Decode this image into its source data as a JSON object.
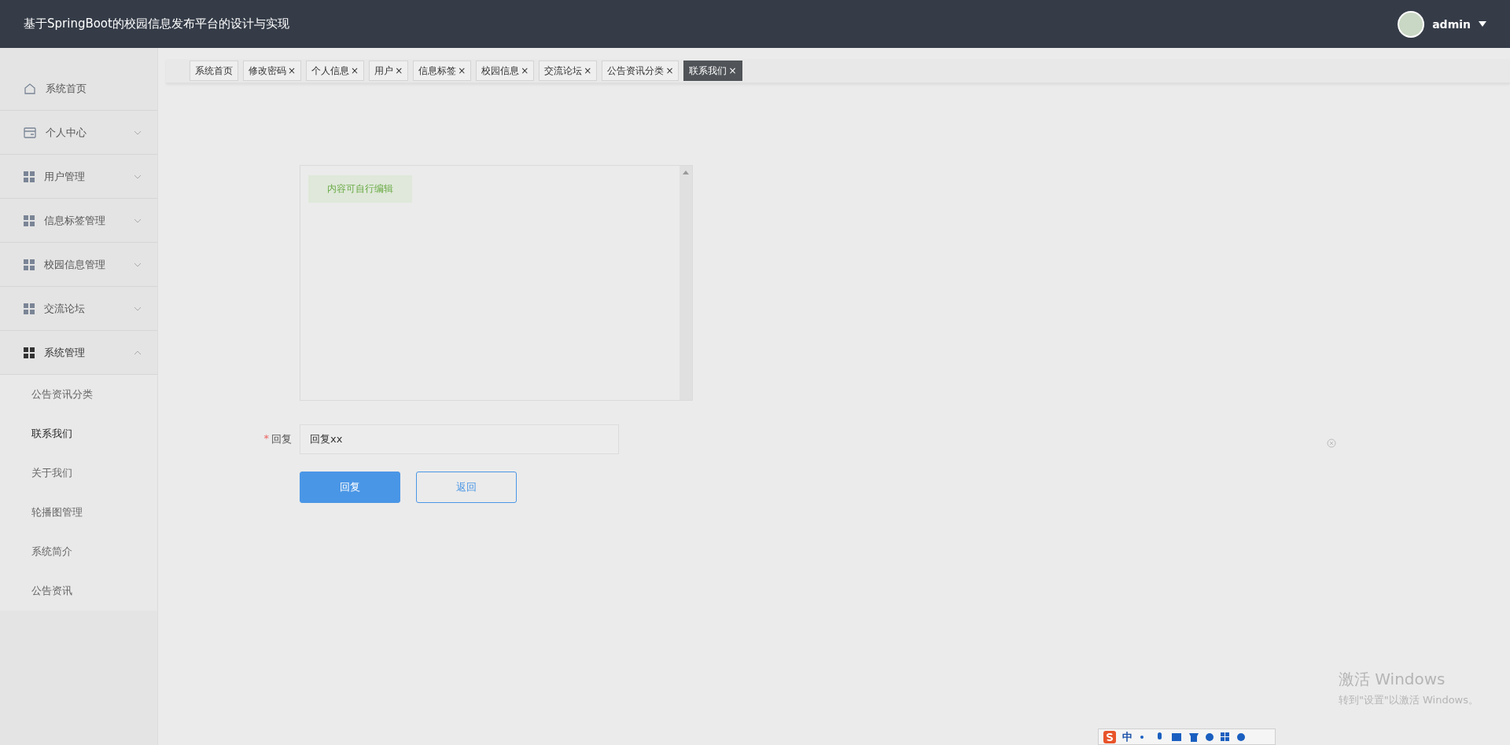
{
  "header": {
    "title": "基于SpringBoot的校园信息发布平台的设计与实现",
    "user": "admin"
  },
  "sidebar": {
    "items": [
      {
        "label": "系统首页",
        "expanded": false,
        "has_children": false
      },
      {
        "label": "个人中心",
        "expanded": false,
        "has_children": true
      },
      {
        "label": "用户管理",
        "expanded": false,
        "has_children": true
      },
      {
        "label": "信息标签管理",
        "expanded": false,
        "has_children": true
      },
      {
        "label": "校园信息管理",
        "expanded": false,
        "has_children": true
      },
      {
        "label": "交流论坛",
        "expanded": false,
        "has_children": true
      },
      {
        "label": "系统管理",
        "expanded": true,
        "has_children": true,
        "children": [
          {
            "label": "公告资讯分类",
            "selected": false
          },
          {
            "label": "联系我们",
            "selected": true
          },
          {
            "label": "关于我们",
            "selected": false
          },
          {
            "label": "轮播图管理",
            "selected": false
          },
          {
            "label": "系统简介",
            "selected": false
          },
          {
            "label": "公告资讯",
            "selected": false
          }
        ]
      }
    ]
  },
  "tabs": [
    {
      "label": "系统首页",
      "closable": false,
      "selected": false
    },
    {
      "label": "修改密码",
      "closable": true,
      "selected": false
    },
    {
      "label": "个人信息",
      "closable": true,
      "selected": false
    },
    {
      "label": "用户",
      "closable": true,
      "selected": false
    },
    {
      "label": "信息标签",
      "closable": true,
      "selected": false
    },
    {
      "label": "校园信息",
      "closable": true,
      "selected": false
    },
    {
      "label": "交流论坛",
      "closable": true,
      "selected": false
    },
    {
      "label": "公告资讯分类",
      "closable": true,
      "selected": false
    },
    {
      "label": "联系我们",
      "closable": true,
      "selected": true
    }
  ],
  "close_glyph": "×",
  "form": {
    "editor": {
      "content": "内容可自行编辑"
    },
    "reply": {
      "label": "回复",
      "required_mark": "*",
      "value": "回复xx"
    },
    "buttons": [
      {
        "label": "回复",
        "kind": "primary"
      },
      {
        "label": "返回",
        "kind": "outline"
      }
    ]
  },
  "os_overlay": {
    "activation_title": "激活 Windows",
    "activation_hint": "转到\"设置\"以激活 Windows。",
    "ime_label": "中"
  }
}
